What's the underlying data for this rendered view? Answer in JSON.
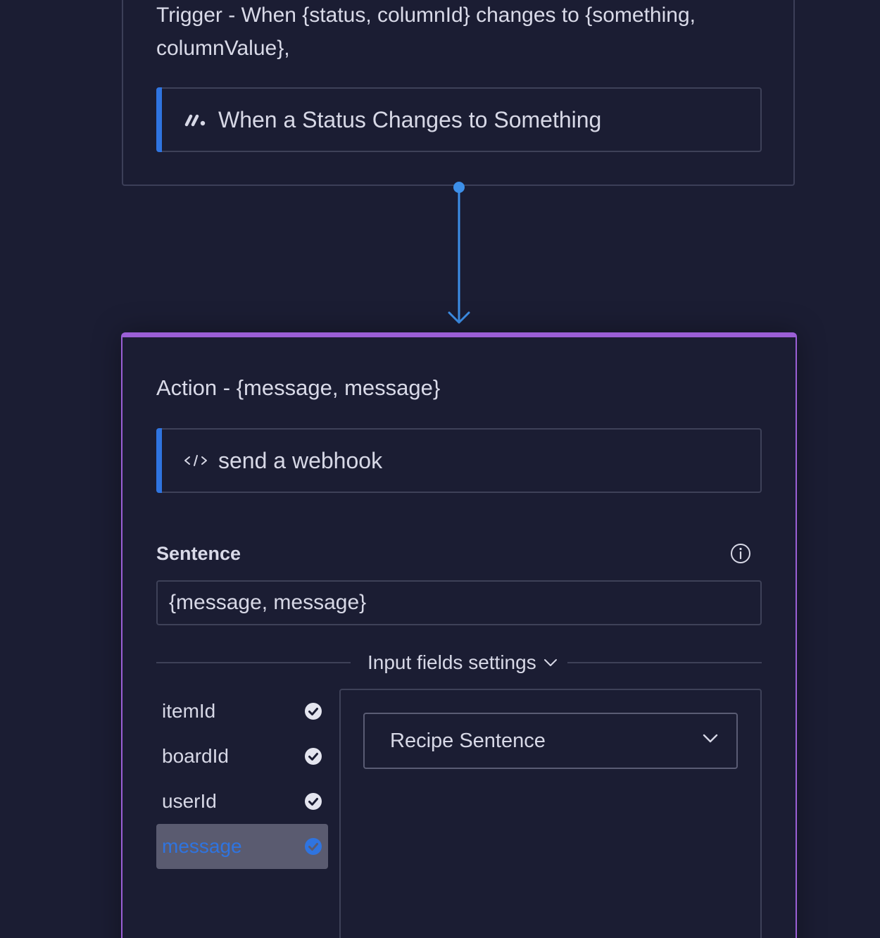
{
  "trigger": {
    "title": "Trigger - When {status, columnId} changes to {something, columnValue},",
    "block_label": "When a Status Changes to Something",
    "block_icon": "monday-logo-icon"
  },
  "action": {
    "title": "Action - {message, message}",
    "block_label": "send a webhook",
    "block_icon": "code-icon",
    "sentence_label": "Sentence",
    "sentence_value": "{message, message}",
    "settings_toggle_label": "Input fields settings",
    "fields": [
      {
        "label": "itemId",
        "selected": false
      },
      {
        "label": "boardId",
        "selected": false
      },
      {
        "label": "userId",
        "selected": false
      },
      {
        "label": "message",
        "selected": true
      }
    ],
    "select_value": "Recipe Sentence"
  },
  "colors": {
    "background": "#1b1d33",
    "accent_blue": "#2f74e0",
    "connector_blue": "#3d8fe8",
    "action_border_purple": "#9b5fd6",
    "border_gray": "#3e4158",
    "selected_row_bg": "#5a5b70"
  }
}
